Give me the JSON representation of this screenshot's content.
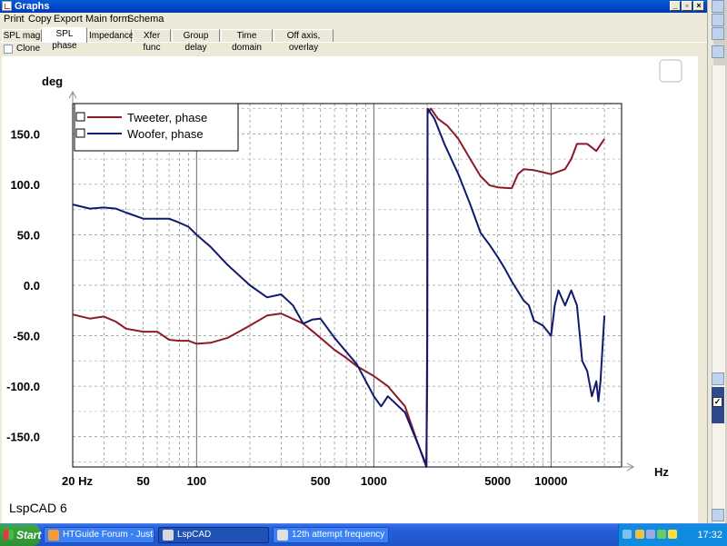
{
  "window": {
    "title": "Graphs",
    "controls": {
      "minimize": "_",
      "maximize": "▫",
      "close": "×"
    }
  },
  "menu": [
    "Print",
    "Copy",
    "Export",
    "Main form",
    "Schema"
  ],
  "tabs": [
    {
      "label": "SPL mag",
      "active": false
    },
    {
      "label": "SPL phase",
      "active": true
    },
    {
      "label": "Impedance",
      "active": false
    },
    {
      "label": "Xfer func",
      "active": false
    },
    {
      "label": "Group delay",
      "active": false
    },
    {
      "label": "Time domain",
      "active": false
    },
    {
      "label": "Off axis, overlay",
      "active": false
    }
  ],
  "clone": {
    "label": "Clone",
    "checked": false
  },
  "watermark": "LspCAD 6",
  "chart_data": {
    "type": "line",
    "ylabel": "deg",
    "xlabel": "Hz",
    "x_scale": "log",
    "xlim": [
      20,
      25000
    ],
    "ylim": [
      -180,
      180
    ],
    "y_ticks": [
      "150.0",
      "100.0",
      "50.0",
      "0.0",
      "-50.0",
      "-100.0",
      "-150.0"
    ],
    "y_tick_values": [
      150,
      100,
      50,
      0,
      -50,
      -100,
      -150
    ],
    "x_ticks": [
      "20 Hz",
      "50",
      "100",
      "500",
      "1000",
      "5000",
      "10000"
    ],
    "x_tick_values": [
      20,
      50,
      100,
      500,
      1000,
      5000,
      10000
    ],
    "grid": true,
    "legend_position": "top-left",
    "series": [
      {
        "name": "Tweeter, phase",
        "color": "#8b1a2a",
        "points": [
          [
            20,
            -29
          ],
          [
            25,
            -33
          ],
          [
            30,
            -31
          ],
          [
            35,
            -36
          ],
          [
            40,
            -43
          ],
          [
            50,
            -46
          ],
          [
            60,
            -46
          ],
          [
            70,
            -54
          ],
          [
            80,
            -55
          ],
          [
            90,
            -55
          ],
          [
            100,
            -58
          ],
          [
            120,
            -57
          ],
          [
            150,
            -52
          ],
          [
            200,
            -40
          ],
          [
            250,
            -30
          ],
          [
            300,
            -28
          ],
          [
            400,
            -38
          ],
          [
            500,
            -52
          ],
          [
            600,
            -64
          ],
          [
            700,
            -72
          ],
          [
            800,
            -80
          ],
          [
            1000,
            -90
          ],
          [
            1200,
            -100
          ],
          [
            1500,
            -120
          ],
          [
            1800,
            -160
          ],
          [
            1980,
            -178
          ],
          [
            2000,
            -100
          ],
          [
            2010,
            170
          ],
          [
            2100,
            175
          ],
          [
            2300,
            165
          ],
          [
            2600,
            158
          ],
          [
            3000,
            145
          ],
          [
            3500,
            125
          ],
          [
            4000,
            108
          ],
          [
            4500,
            99
          ],
          [
            5000,
            97
          ],
          [
            6000,
            96
          ],
          [
            6500,
            110
          ],
          [
            7000,
            115
          ],
          [
            8000,
            114
          ],
          [
            9000,
            112
          ],
          [
            10000,
            110
          ],
          [
            12000,
            115
          ],
          [
            13000,
            125
          ],
          [
            14000,
            140
          ],
          [
            16000,
            140
          ],
          [
            18000,
            133
          ],
          [
            20000,
            145
          ]
        ]
      },
      {
        "name": "Woofer, phase",
        "color": "#0f1a6e",
        "points": [
          [
            20,
            80
          ],
          [
            25,
            76
          ],
          [
            30,
            77
          ],
          [
            35,
            76
          ],
          [
            40,
            72
          ],
          [
            50,
            66
          ],
          [
            60,
            66
          ],
          [
            70,
            66
          ],
          [
            80,
            62
          ],
          [
            90,
            58
          ],
          [
            100,
            50
          ],
          [
            120,
            38
          ],
          [
            150,
            20
          ],
          [
            200,
            0
          ],
          [
            250,
            -12
          ],
          [
            300,
            -9
          ],
          [
            350,
            -20
          ],
          [
            400,
            -38
          ],
          [
            450,
            -34
          ],
          [
            500,
            -33
          ],
          [
            600,
            -52
          ],
          [
            700,
            -66
          ],
          [
            800,
            -78
          ],
          [
            1000,
            -110
          ],
          [
            1100,
            -120
          ],
          [
            1200,
            -110
          ],
          [
            1500,
            -126
          ],
          [
            1800,
            -160
          ],
          [
            1980,
            -180
          ],
          [
            2000,
            -50
          ],
          [
            2010,
            175
          ],
          [
            2200,
            165
          ],
          [
            2500,
            140
          ],
          [
            3000,
            110
          ],
          [
            3500,
            80
          ],
          [
            4000,
            52
          ],
          [
            4500,
            40
          ],
          [
            5000,
            28
          ],
          [
            5500,
            16
          ],
          [
            6000,
            4
          ],
          [
            7000,
            -15
          ],
          [
            7500,
            -20
          ],
          [
            8000,
            -35
          ],
          [
            9000,
            -40
          ],
          [
            10000,
            -50
          ],
          [
            10500,
            -20
          ],
          [
            11000,
            -5
          ],
          [
            12000,
            -20
          ],
          [
            13000,
            -5
          ],
          [
            14000,
            -20
          ],
          [
            15000,
            -75
          ],
          [
            16000,
            -85
          ],
          [
            17000,
            -110
          ],
          [
            18000,
            -95
          ],
          [
            18500,
            -115
          ],
          [
            19000,
            -95
          ],
          [
            20000,
            -30
          ]
        ]
      }
    ]
  },
  "taskbar": {
    "start": "Start",
    "tasks": [
      {
        "label": "HTGuide Forum - JustML...",
        "active": false,
        "icon_color": "#f29a3a"
      },
      {
        "label": "LspCAD",
        "active": true,
        "icon_color": "#d8d8d8"
      },
      {
        "label": "12th attempt frequency ...",
        "active": false,
        "icon_color": "#e0e0e0"
      }
    ],
    "clock": "17:32",
    "tray_icon_colors": [
      "#7ec0f0",
      "#f0c040",
      "#9ad",
      "#6c6",
      "#fd4"
    ]
  }
}
